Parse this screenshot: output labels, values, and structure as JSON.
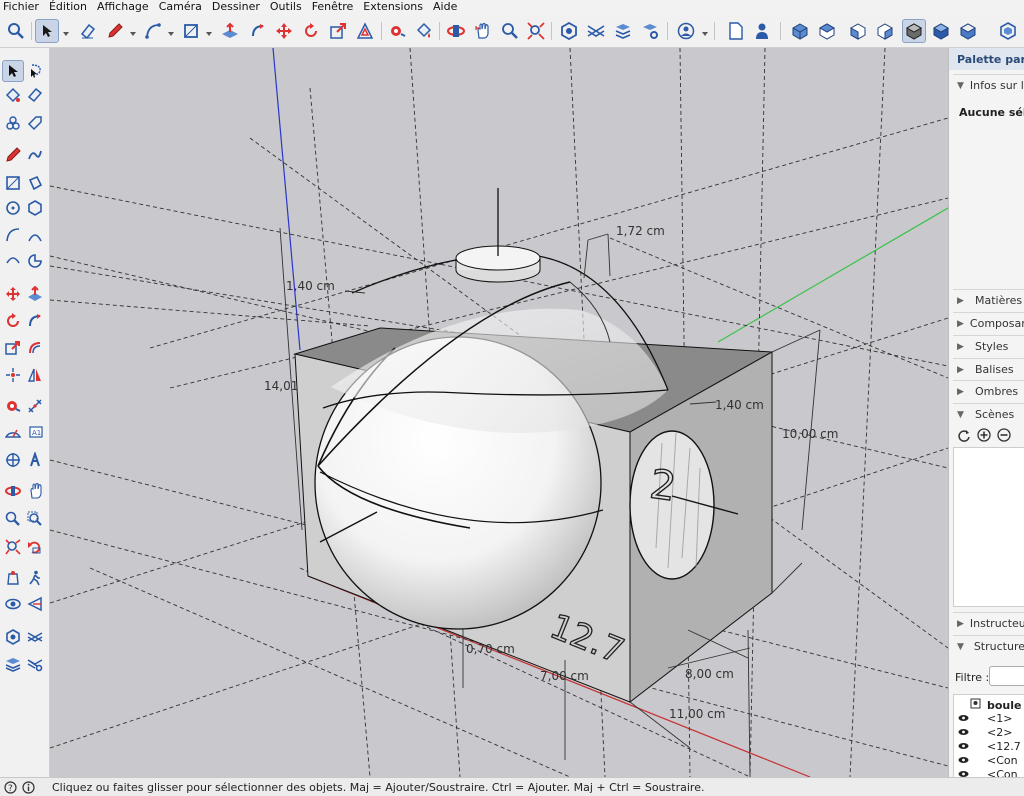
{
  "menu": [
    "Fichier",
    "Édition",
    "Affichage",
    "Caméra",
    "Dessiner",
    "Outils",
    "Fenêtre",
    "Extensions",
    "Aide"
  ],
  "tray": {
    "title": "Palette par dé",
    "entity_info": {
      "label": "Infos sur l'e",
      "value": "Aucune sélec"
    },
    "panels": [
      "Matières",
      "Composan",
      "Styles",
      "Balises",
      "Ombres",
      "Scènes"
    ],
    "instructor": "Instructeur",
    "outliner": {
      "label": "Structure",
      "filter_label": "Filtre :",
      "filter_value": "",
      "root": "boule",
      "items": [
        "<1>",
        "<2>",
        "<12.7",
        "<Con",
        "<Con"
      ]
    }
  },
  "viewport": {
    "dimensions": [
      "1,72 cm",
      "1,40 cm",
      "14,01",
      "1,40 cm",
      "10,00 cm",
      "0,70 cm",
      "7,00 cm",
      "8,00 cm",
      "11,00 cm"
    ],
    "engraved_text": [
      "2",
      "12.7"
    ]
  },
  "status": {
    "message": "Cliquez ou faites glisser pour sélectionner des objets. Maj = Ajouter/Soustraire. Ctrl = Ajouter. Maj + Ctrl = Soustraire."
  },
  "colors": {
    "viewport_bg": "#c8c8cd",
    "axis_blue": "#2a36c8",
    "axis_green": "#3bc24a",
    "axis_red": "#c83232",
    "selection_accent": "#c9d5e6"
  }
}
